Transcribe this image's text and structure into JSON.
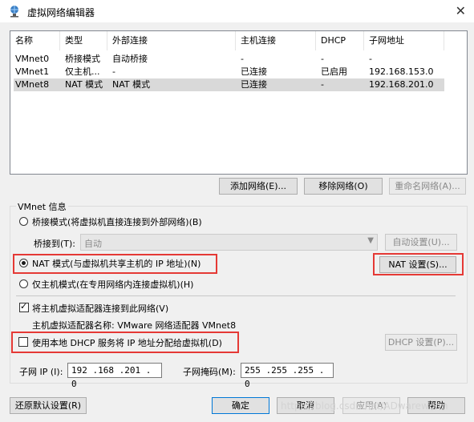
{
  "window": {
    "title": "虚拟网络编辑器",
    "close_glyph": "✕"
  },
  "table": {
    "columns": [
      "名称",
      "类型",
      "外部连接",
      "主机连接",
      "DHCP",
      "子网地址"
    ],
    "rows": [
      [
        "VMnet0",
        "桥接模式",
        "自动桥接",
        "-",
        "-",
        "-"
      ],
      [
        "VMnet1",
        "仅主机...",
        "-",
        "已连接",
        "已启用",
        "192.168.153.0"
      ],
      [
        "VMnet8",
        "NAT 模式",
        "NAT 模式",
        "已连接",
        "-",
        "192.168.201.0"
      ]
    ],
    "selected_row": 2
  },
  "network_buttons": {
    "add": "添加网络(E)...",
    "remove": "移除网络(O)",
    "rename": "重命名网络(A)..."
  },
  "vmnet_info": {
    "group_label": "VMnet 信息",
    "bridged_label": "桥接模式(将虚拟机直接连接到外部网络)(B)",
    "bridge_to_label": "桥接到(T):",
    "bridge_to_value": "自动",
    "auto_settings": "自动设置(U)...",
    "nat_label": "NAT 模式(与虚拟机共享主机的 IP 地址)(N)",
    "nat_settings": "NAT 设置(S)...",
    "hostonly_label": "仅主机模式(在专用网络内连接虚拟机)(H)",
    "connect_adapter_label": "将主机虚拟适配器连接到此网络(V)",
    "adapter_name_label": "主机虚拟适配器名称: VMware 网络适配器 VMnet8",
    "dhcp_label": "使用本地 DHCP 服务将 IP 地址分配给虚拟机(D)",
    "dhcp_settings": "DHCP 设置(P)...",
    "subnet_ip_label": "子网 IP (I):",
    "subnet_ip_value": "192 .168 .201 . 0",
    "subnet_mask_label": "子网掩码(M):",
    "subnet_mask_value": "255 .255 .255 . 0"
  },
  "footer": {
    "restore": "还原默认设置(R)",
    "ok": "确定",
    "cancel": "取消",
    "apply": "应用(A)",
    "help": "帮助"
  },
  "watermark": "https://blog.csdn.net/ADwareworm",
  "colors": {
    "highlight_box": "#e53935",
    "selected_row": "#d9d9d9"
  },
  "icons": {
    "app": "network-globe-icon",
    "close": "close-icon",
    "combo_arrow": "chevron-down-icon"
  }
}
